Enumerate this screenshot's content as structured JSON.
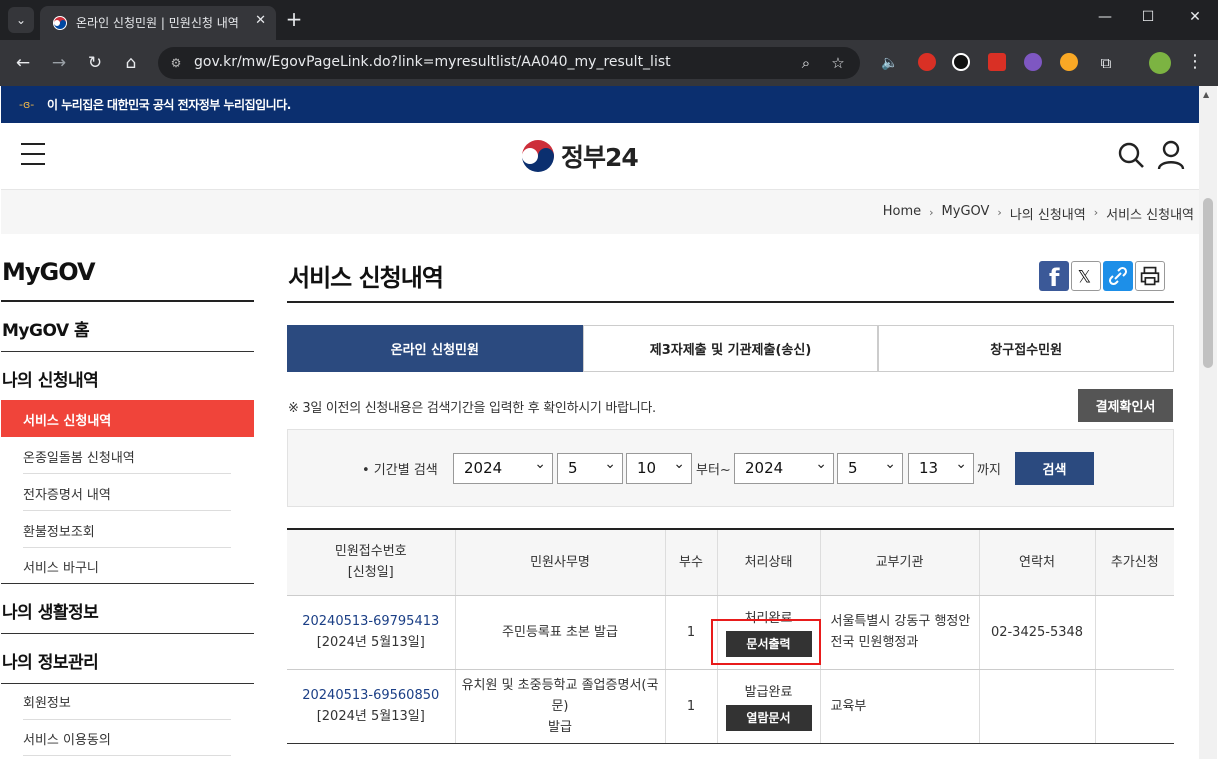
{
  "browser": {
    "tab_title": "온라인 신청민원 | 민원신청 내역",
    "tab_close": "✕",
    "new_tab": "+",
    "url": "gov.kr/mw/EgovPageLink.do?link=myresultlist/AA040_my_result_list",
    "window_minimize": "—",
    "window_maximize": "☐",
    "window_close": "✕"
  },
  "gov_banner": {
    "text": "이 누리집은 대한민국 공식 전자정부 누리집입니다."
  },
  "header": {
    "logo_text": "정부24"
  },
  "breadcrumb": [
    "Home",
    "MyGOV",
    "나의 신청내역",
    "서비스 신청내역"
  ],
  "sidebar": {
    "title": "MyGOV",
    "home": "MyGOV 홈",
    "section1": "나의 신청내역",
    "section1_items": [
      "서비스 신청내역",
      "온종일돌봄 신청내역",
      "전자증명서 내역",
      "환불정보조회",
      "서비스 바구니"
    ],
    "section2": "나의 생활정보",
    "section3": "나의 정보관리",
    "section3_items": [
      "회원정보",
      "서비스 이용동의"
    ]
  },
  "main": {
    "title": "서비스 신청내역",
    "tabs": [
      "온라인 신청민원",
      "제3자제출 및 기관제출(송신)",
      "창구접수민원"
    ],
    "notice": "※ 3일 이전의 신청내용은 검색기간을 입력한 후 확인하시기 바랍니다.",
    "confirm_button": "결제확인서",
    "search": {
      "label": "• 기간별 검색",
      "from_year": "2024",
      "from_month": "5",
      "from_day": "10",
      "from_suffix": "부터~",
      "to_year": "2024",
      "to_month": "5",
      "to_day": "13",
      "to_suffix": "까지",
      "button": "검색"
    },
    "table": {
      "headers": [
        "민원접수번호",
        "[신청일]",
        "민원사무명",
        "부수",
        "처리상태",
        "교부기관",
        "연락처",
        "추가신청"
      ],
      "rows": [
        {
          "no": "20240513-69795413",
          "date": "[2024년 5월13일]",
          "name": "주민등록표 초본 발급",
          "copies": "1",
          "status": "처리완료",
          "status_btn": "문서출력",
          "org_line1": "서울특별시 강동구 행정안",
          "org_line2": "전국 민원행정과",
          "phone": "02-3425-5348",
          "extra": ""
        },
        {
          "no": "20240513-69560850",
          "date": "[2024년 5월13일]",
          "name_line1": "유치원 및 초중등학교 졸업증명서(국문)",
          "name_line2": "발급",
          "copies": "1",
          "status": "발급완료",
          "status_btn": "열람문서",
          "org_line1": "교육부",
          "org_line2": "",
          "phone": "",
          "extra": ""
        }
      ]
    }
  },
  "colors": {
    "gov_navy": "#0b2f6f",
    "tab_active": "#2b4a7f",
    "sidebar_active": "#f0443a",
    "highlight": "#e81b1b"
  }
}
